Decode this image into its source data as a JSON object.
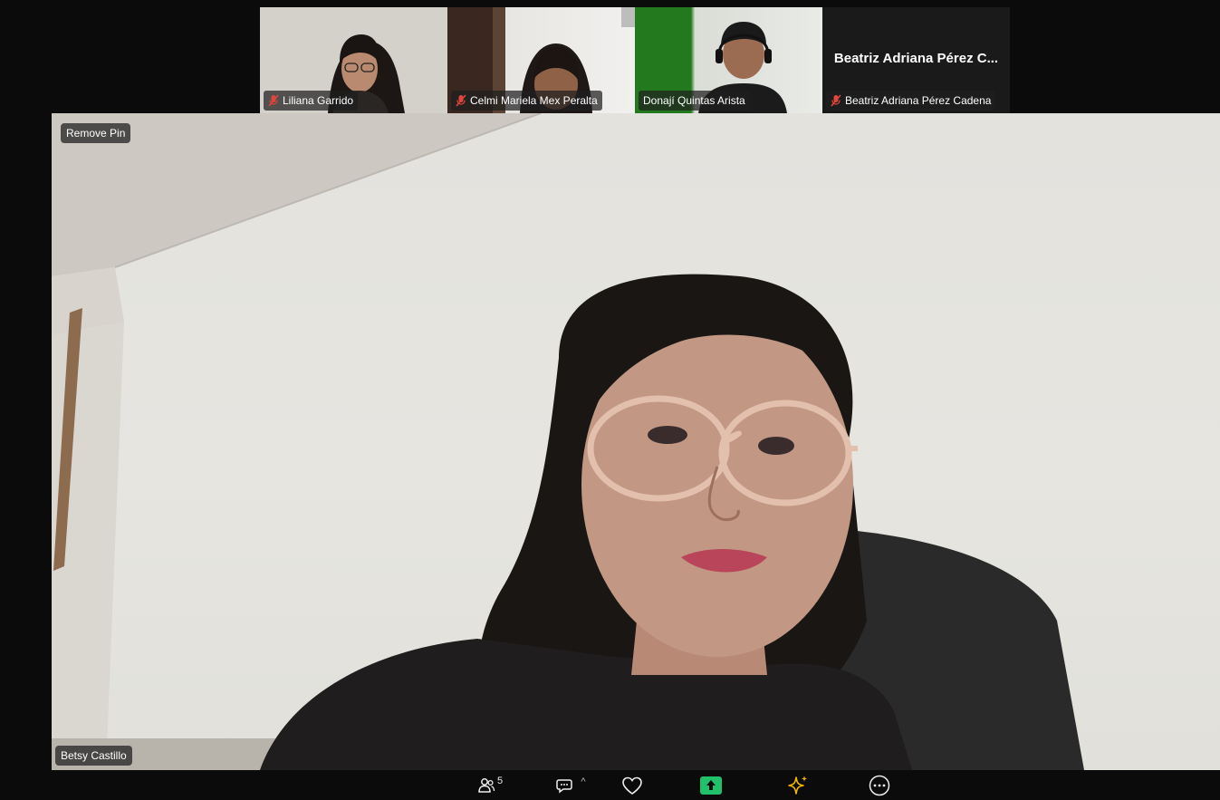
{
  "thumbnails": [
    {
      "name": "Liliana Garrido",
      "muted": true,
      "active": false,
      "has_video": true
    },
    {
      "name": "Celmi Mariela Mex Peralta",
      "muted": true,
      "active": false,
      "has_video": true
    },
    {
      "name": "Donají Quintas Arista",
      "muted": false,
      "active": true,
      "has_video": true
    },
    {
      "name": "Beatriz Adriana Pérez Cadena",
      "title": "Beatriz Adriana Pérez C...",
      "muted": true,
      "active": false,
      "has_video": false
    }
  ],
  "main_video": {
    "pin_label": "Remove Pin",
    "name": "Betsy Castillo"
  },
  "toolbar": {
    "participants_count": "5",
    "participants_icon": "participants-icon",
    "chat_icon": "chat-icon",
    "chat_caret": "^",
    "reactions_icon": "heart-icon",
    "share_icon": "share-screen-icon",
    "ai_icon": "sparkle-icon",
    "more_icon": "more-icon"
  },
  "colors": {
    "active_border": "#c8e06a",
    "share_green": "#21c16b",
    "ai_gold": "#f2b705",
    "mute_red": "#e0463a"
  }
}
